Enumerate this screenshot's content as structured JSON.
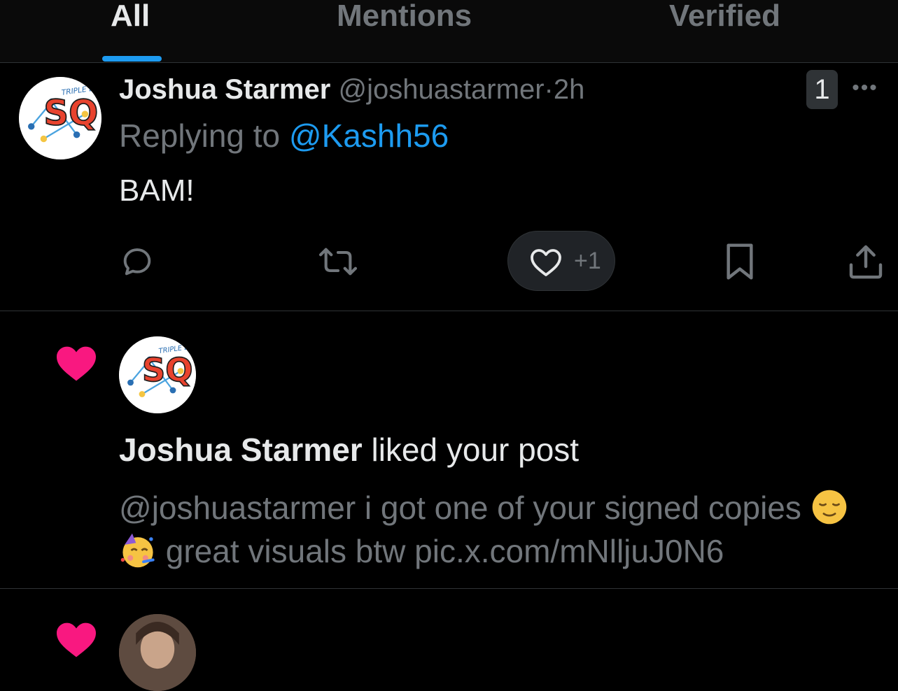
{
  "tabs": [
    {
      "label": "All",
      "active": true
    },
    {
      "label": "Mentions",
      "active": false
    },
    {
      "label": "Verified",
      "active": false
    }
  ],
  "post": {
    "author_name": "Joshua Starmer",
    "handle": "@joshuastarmer",
    "separator": "·",
    "time": "2h",
    "replying_prefix": "Replying to ",
    "replying_to": "@Kashh56",
    "text": "BAM!",
    "badge_count": "1",
    "more_label": "•••",
    "like_count": "+1",
    "avatar_text": "SQ",
    "avatar_subtext": "TRIPLE BAM!!"
  },
  "notification": {
    "author_name": "Joshua Starmer",
    "action": " liked your post",
    "preview_part1": "@joshuastarmer i got one of your signed copies ",
    "preview_part2": " great visuals btw pic.x.com/mNlljuJ0N6",
    "avatar_text": "SQ",
    "avatar_subtext": "TRIPLE BAM!!"
  },
  "colors": {
    "accent": "#1d9bf0",
    "heart": "#f91880",
    "text_primary": "#e7e9ea",
    "text_secondary": "#71767b",
    "background": "#000000"
  },
  "icons": {
    "reply": "reply-icon",
    "repost": "repost-icon",
    "like": "heart-outline-icon",
    "bookmark": "bookmark-icon",
    "share": "share-icon",
    "notif_like": "heart-filled-icon"
  }
}
